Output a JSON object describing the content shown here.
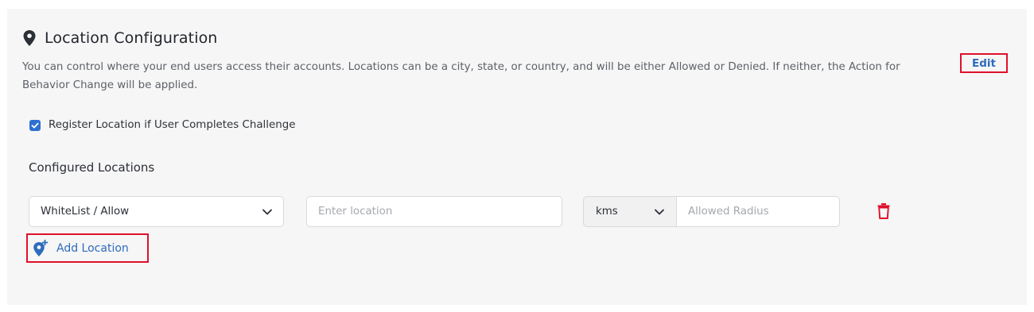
{
  "section": {
    "title": "Location Configuration",
    "description": "You can control where your end users access their accounts. Locations can be a city, state, or country, and will be either Allowed or Denied. If neither, the Action for Behavior Change will be applied.",
    "edit_label": "Edit"
  },
  "register_checkbox": {
    "label": "Register Location if User Completes Challenge",
    "checked": true
  },
  "configured": {
    "title": "Configured Locations",
    "row": {
      "rule_value": "WhiteList / Allow",
      "location_placeholder": "Enter location",
      "unit_value": "kms",
      "radius_placeholder": "Allowed Radius"
    },
    "add_label": "Add Location"
  },
  "colors": {
    "accent": "#2e6bbd",
    "checkbox": "#2f6fd1",
    "delete": "#e0102a",
    "highlight_border": "#e0102a"
  },
  "icons": [
    "map-pin-icon",
    "check-icon",
    "chevron-down-icon",
    "trash-icon",
    "add-location-icon"
  ]
}
